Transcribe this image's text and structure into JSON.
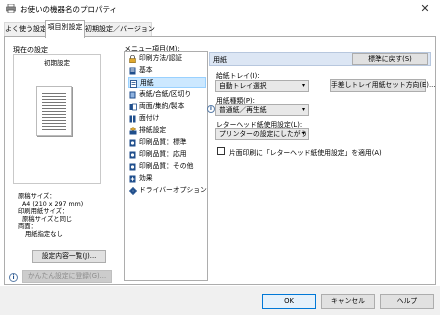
{
  "window": {
    "title": "お使いの機器名のプロパティ"
  },
  "tabs": [
    {
      "label": "よく使う設定",
      "active": false
    },
    {
      "label": "項目別設定",
      "active": true
    },
    {
      "label": "初期設定／バージョン",
      "active": false
    }
  ],
  "left": {
    "current_label": "現在の設定",
    "preview_caption": "初期設定",
    "info_lines": [
      "原稿サイズ：",
      "A4 (210 x 297 mm)",
      "印刷用紙サイズ：",
      "原稿サイズと同じ",
      "両面：",
      "用紙指定なし"
    ],
    "details_button": "設定内容一覧(J)...",
    "register_button": "かんたん設定に登録(G)..."
  },
  "menu": {
    "label": "メニュー項目(M):",
    "items": [
      {
        "label": "印刷方法/認証",
        "selected": false
      },
      {
        "label": "基本",
        "selected": false
      },
      {
        "label": "用紙",
        "selected": true
      },
      {
        "label": "表紙/合紙/区切り",
        "selected": false
      },
      {
        "label": "両面/集約/製本",
        "selected": false
      },
      {
        "label": "面付け",
        "selected": false
      },
      {
        "label": "排紙設定",
        "selected": false
      },
      {
        "label": "印刷品質：標準",
        "selected": false
      },
      {
        "label": "印刷品質：応用",
        "selected": false
      },
      {
        "label": "印刷品質：その他",
        "selected": false
      },
      {
        "label": "効果",
        "selected": false
      },
      {
        "label": "ドライバーオプション",
        "selected": false
      }
    ]
  },
  "panel": {
    "section_title": "用紙",
    "reset_button": "標準に戻す(S)",
    "tray_label": "給紙トレイ(I):",
    "tray_value": "自動トレイ選択",
    "bypass_button": "手差しトレイ用紙セット方向(E)...",
    "paper_type_label": "用紙種類(P):",
    "paper_type_value": "普通紙／再生紙",
    "letterhead_label": "レターヘッド紙使用設定(L):",
    "letterhead_value": "プリンターの設定にしたがう",
    "simplex_checkbox": "片面印刷に「レターヘッド紙使用設定」を適用(A)",
    "simplex_checked": false
  },
  "footer": {
    "ok": "OK",
    "cancel": "キャンセル",
    "help": "ヘルプ"
  },
  "colors": {
    "selection": "#cce8ff",
    "header": "#dce6f4",
    "accent": "#0078d7"
  }
}
